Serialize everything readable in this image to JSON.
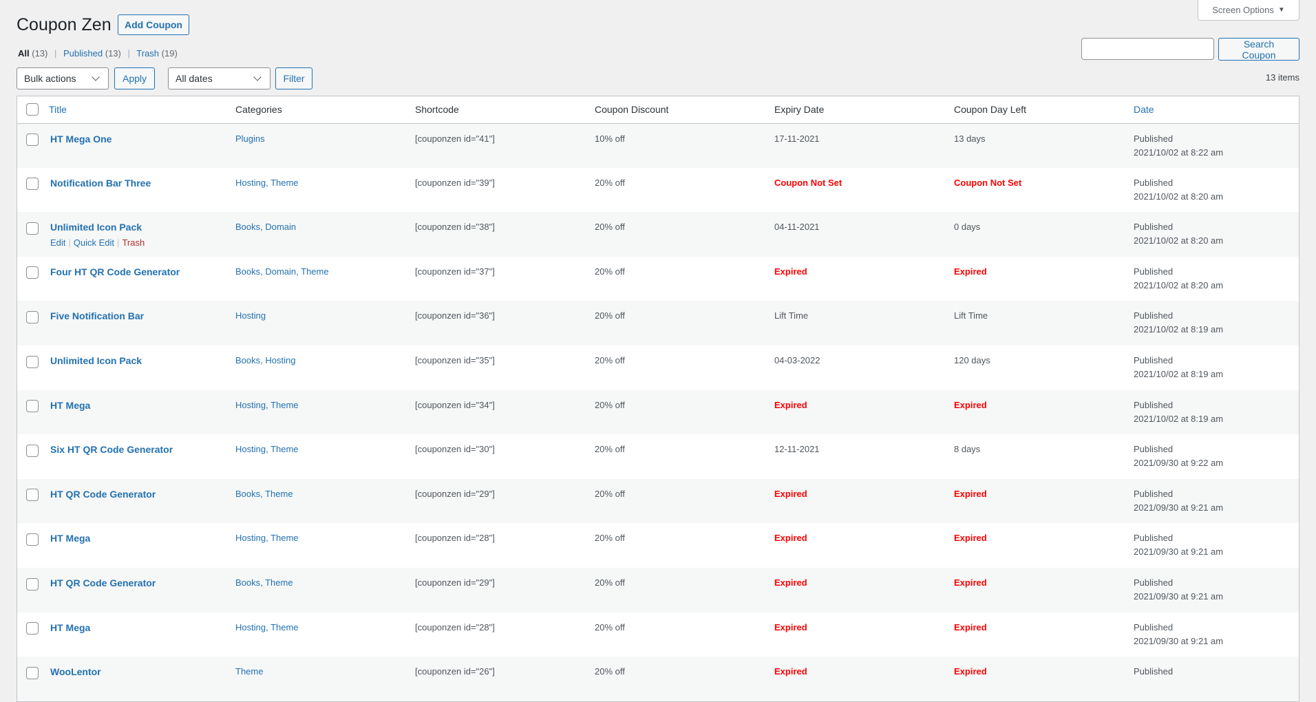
{
  "header": {
    "title": "Coupon Zen",
    "add_button": "Add Coupon",
    "screen_options": "Screen Options",
    "screen_options_icon": "triangle-down-icon"
  },
  "views": {
    "all_label": "All",
    "all_count": "(13)",
    "published_label": "Published",
    "published_count": "(13)",
    "trash_label": "Trash",
    "trash_count": "(19)",
    "separator": "|"
  },
  "toolbar": {
    "bulk_actions": "Bulk actions",
    "apply": "Apply",
    "dates": "All dates",
    "filter": "Filter",
    "search_value": "",
    "search_button": "Search Coupon",
    "items_count": "13 items"
  },
  "colors": {
    "link": "#2271b1",
    "status_red": "#ff0000",
    "trash": "#b32d2e",
    "background": "#f0f0f1"
  },
  "table": {
    "columns": [
      "Title",
      "Categories",
      "Shortcode",
      "Coupon Discount",
      "Expiry Date",
      "Coupon Day Left",
      "Date"
    ],
    "row_actions": {
      "edit": "Edit",
      "quick_edit": "Quick Edit",
      "trash": "Trash"
    },
    "rows": [
      {
        "title": "HT Mega One",
        "categories": "Plugins",
        "shortcode": "[couponzen id=\"41\"]",
        "discount": "10% off",
        "expiry": "17-11-2021",
        "expiry_alert": false,
        "days_left": "13 days",
        "days_alert": false,
        "status": "Published",
        "date": "2021/10/02 at 8:22 am",
        "show_actions": false
      },
      {
        "title": "Notification Bar Three",
        "categories": "Hosting, Theme",
        "shortcode": "[couponzen id=\"39\"]",
        "discount": "20% off",
        "expiry": "Coupon Not Set",
        "expiry_alert": true,
        "days_left": "Coupon Not Set",
        "days_alert": true,
        "status": "Published",
        "date": "2021/10/02 at 8:20 am",
        "show_actions": false
      },
      {
        "title": "Unlimited Icon Pack",
        "categories": "Books, Domain",
        "shortcode": "[couponzen id=\"38\"]",
        "discount": "20% off",
        "expiry": "04-11-2021",
        "expiry_alert": false,
        "days_left": "0 days",
        "days_alert": false,
        "status": "Published",
        "date": "2021/10/02 at 8:20 am",
        "show_actions": true
      },
      {
        "title": "Four HT QR Code Generator",
        "categories": "Books, Domain, Theme",
        "shortcode": "[couponzen id=\"37\"]",
        "discount": "20% off",
        "expiry": "Expired",
        "expiry_alert": true,
        "days_left": "Expired",
        "days_alert": true,
        "status": "Published",
        "date": "2021/10/02 at 8:20 am",
        "show_actions": false
      },
      {
        "title": "Five Notification Bar",
        "categories": "Hosting",
        "shortcode": "[couponzen id=\"36\"]",
        "discount": "20% off",
        "expiry": "Lift Time",
        "expiry_alert": false,
        "days_left": "Lift Time",
        "days_alert": false,
        "status": "Published",
        "date": "2021/10/02 at 8:19 am",
        "show_actions": false
      },
      {
        "title": "Unlimited Icon Pack",
        "categories": "Books, Hosting",
        "shortcode": "[couponzen id=\"35\"]",
        "discount": "20% off",
        "expiry": "04-03-2022",
        "expiry_alert": false,
        "days_left": "120 days",
        "days_alert": false,
        "status": "Published",
        "date": "2021/10/02 at 8:19 am",
        "show_actions": false
      },
      {
        "title": "HT Mega",
        "categories": "Hosting, Theme",
        "shortcode": "[couponzen id=\"34\"]",
        "discount": "20% off",
        "expiry": "Expired",
        "expiry_alert": true,
        "days_left": "Expired",
        "days_alert": true,
        "status": "Published",
        "date": "2021/10/02 at 8:19 am",
        "show_actions": false
      },
      {
        "title": "Six HT QR Code Generator",
        "categories": "Hosting, Theme",
        "shortcode": "[couponzen id=\"30\"]",
        "discount": "20% off",
        "expiry": "12-11-2021",
        "expiry_alert": false,
        "days_left": "8 days",
        "days_alert": false,
        "status": "Published",
        "date": "2021/09/30 at 9:22 am",
        "show_actions": false
      },
      {
        "title": "HT QR Code Generator",
        "categories": "Books, Theme",
        "shortcode": "[couponzen id=\"29\"]",
        "discount": "20% off",
        "expiry": "Expired",
        "expiry_alert": true,
        "days_left": "Expired",
        "days_alert": true,
        "status": "Published",
        "date": "2021/09/30 at 9:21 am",
        "show_actions": false
      },
      {
        "title": "HT Mega",
        "categories": "Hosting, Theme",
        "shortcode": "[couponzen id=\"28\"]",
        "discount": "20% off",
        "expiry": "Expired",
        "expiry_alert": true,
        "days_left": "Expired",
        "days_alert": true,
        "status": "Published",
        "date": "2021/09/30 at 9:21 am",
        "show_actions": false
      },
      {
        "title": "HT QR Code Generator",
        "categories": "Books, Theme",
        "shortcode": "[couponzen id=\"29\"]",
        "discount": "20% off",
        "expiry": "Expired",
        "expiry_alert": true,
        "days_left": "Expired",
        "days_alert": true,
        "status": "Published",
        "date": "2021/09/30 at 9:21 am",
        "show_actions": false
      },
      {
        "title": "HT Mega",
        "categories": "Hosting, Theme",
        "shortcode": "[couponzen id=\"28\"]",
        "discount": "20% off",
        "expiry": "Expired",
        "expiry_alert": true,
        "days_left": "Expired",
        "days_alert": true,
        "status": "Published",
        "date": "2021/09/30 at 9:21 am",
        "show_actions": false
      },
      {
        "title": "WooLentor",
        "categories": "Theme",
        "shortcode": "[couponzen id=\"26\"]",
        "discount": "20% off",
        "expiry": "Expired",
        "expiry_alert": true,
        "days_left": "Expired",
        "days_alert": true,
        "status": "Published",
        "date": "",
        "show_actions": false
      }
    ]
  }
}
